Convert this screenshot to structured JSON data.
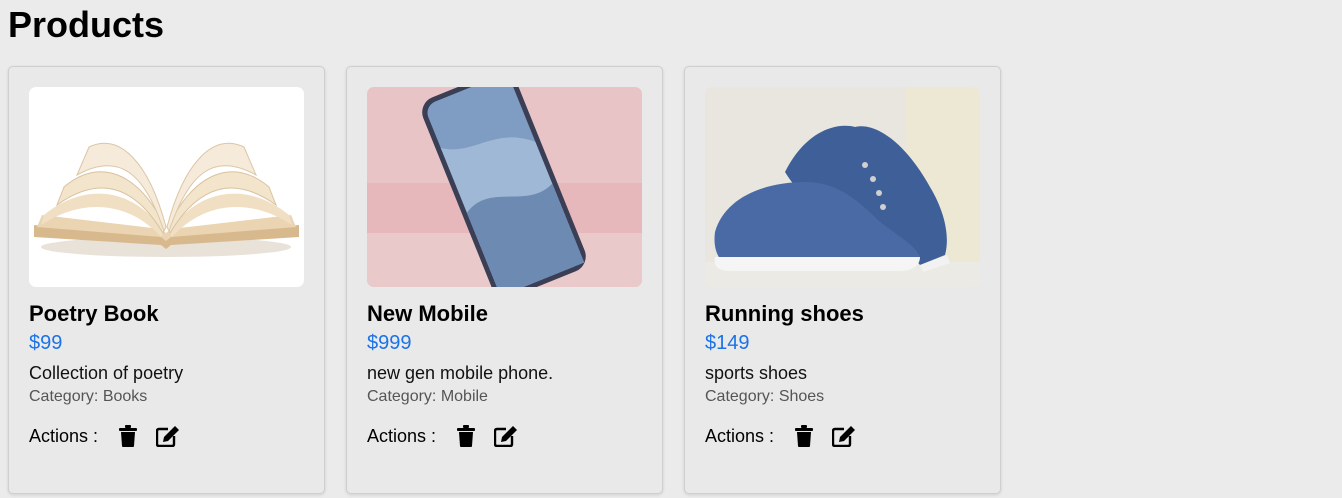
{
  "page": {
    "title": "Products"
  },
  "products": [
    {
      "name": "Poetry Book",
      "price": "$99",
      "description": "Collection of poetry",
      "category": "Category: Books",
      "actions_label": "Actions :",
      "image": "open-book-image"
    },
    {
      "name": "New Mobile",
      "price": "$999",
      "description": "new gen mobile phone.",
      "category": "Category: Mobile",
      "actions_label": "Actions :",
      "image": "smartphone-image"
    },
    {
      "name": "Running shoes",
      "price": "$149",
      "description": "sports shoes",
      "category": "Category: Shoes",
      "actions_label": "Actions :",
      "image": "sneakers-image"
    }
  ],
  "colors": {
    "price": "#1a73e8",
    "background": "#ebebeb"
  },
  "icons": {
    "delete": "trash-icon",
    "edit": "edit-icon"
  }
}
